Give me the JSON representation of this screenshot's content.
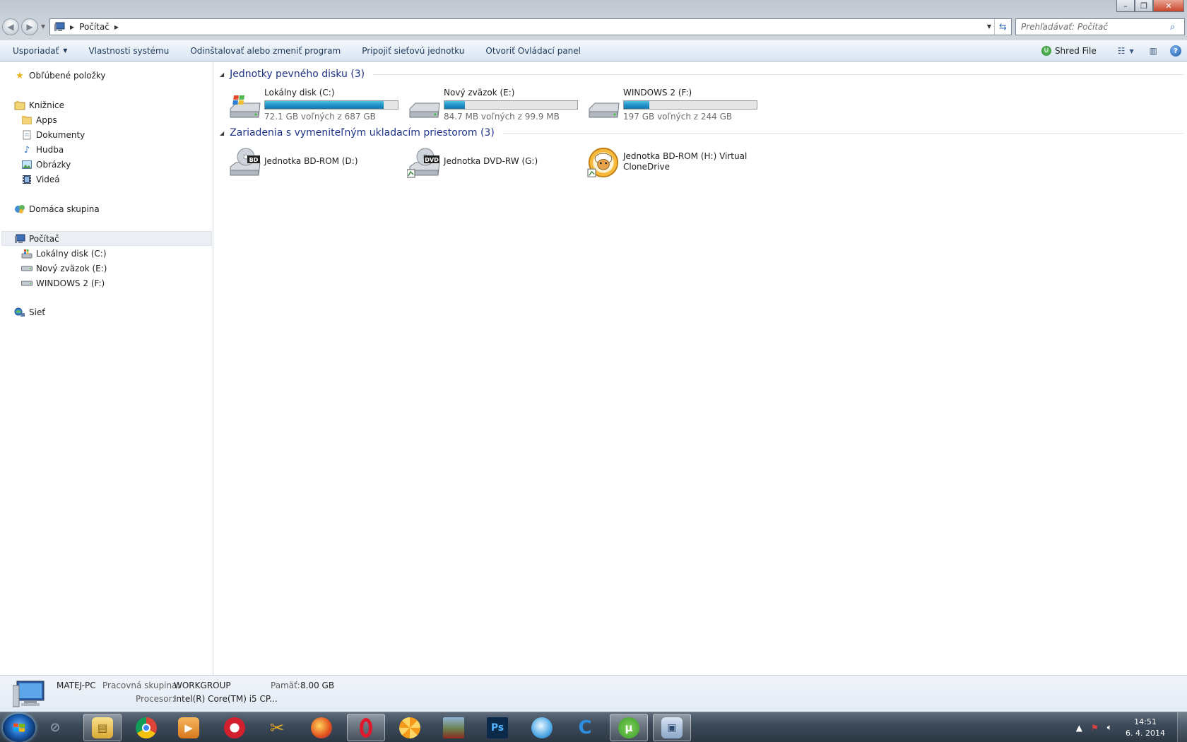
{
  "window": {
    "minimize": "–",
    "maximize": "❐",
    "close": "✕"
  },
  "address": {
    "crumb": "Počítač",
    "search_placeholder": "Prehľadávať: Počítač"
  },
  "commands": {
    "organize": "Usporiadať",
    "system_properties": "Vlastnosti systému",
    "uninstall": "Odinštalovať alebo zmeniť program",
    "map_drive": "Pripojiť sieťovú jednotku",
    "control_panel": "Otvoriť Ovládací panel",
    "shred_file": "Shred File"
  },
  "sidebar": {
    "favorites": "Obľúbené položky",
    "libraries": "Knižnice",
    "library_items": [
      "Apps",
      "Dokumenty",
      "Hudba",
      "Obrázky",
      "Videá"
    ],
    "homegroup": "Domáca skupina",
    "computer": "Počítač",
    "computer_items": [
      "Lokálny disk (C:)",
      "Nový zväzok (E:)",
      "WINDOWS 2 (F:)"
    ],
    "network": "Sieť"
  },
  "groups": {
    "hdd_title": "Jednotky pevného disku (3)",
    "removable_title": "Zariadenia s vymeniteľným ukladacím priestorom (3)"
  },
  "drives": [
    {
      "name": "Lokálny disk (C:)",
      "free": "72.1 GB voľných z 687 GB",
      "used_fraction": 0.895
    },
    {
      "name": "Nový zväzok (E:)",
      "free": "84.7 MB voľných z 99.9 MB",
      "used_fraction": 0.152
    },
    {
      "name": "WINDOWS 2 (F:)",
      "free": "197 GB voľných z 244 GB",
      "used_fraction": 0.193
    }
  ],
  "devices": [
    {
      "name": "Jednotka BD-ROM (D:)",
      "badge": "BD"
    },
    {
      "name": "Jednotka DVD-RW (G:)",
      "badge": "DVD"
    },
    {
      "name": "Jednotka BD-ROM (H:) Virtual CloneDrive"
    }
  ],
  "details": {
    "pc_name": "MATEJ-PC",
    "workgroup_label": "Pracovná skupina:",
    "workgroup": "WORKGROUP",
    "memory_label": "Pamäť:",
    "memory": "8.00 GB",
    "cpu_label": "Procesor:",
    "cpu": "Intel(R) Core(TM) i5 CP..."
  },
  "taskbar": {
    "apps": [
      "explorer",
      "chrome",
      "media-player",
      "opera-next",
      "app-yellow",
      "firefox",
      "opera",
      "orange-app",
      "game",
      "photoshop",
      "safari",
      "ccleaner",
      "utorrent",
      "remote-desktop"
    ],
    "time": "14:51",
    "date": "6. 4. 2014"
  },
  "colors": {
    "accent_bar": "#1e8fc4",
    "group_header": "#1e3287",
    "command_text": "#1e395b"
  }
}
